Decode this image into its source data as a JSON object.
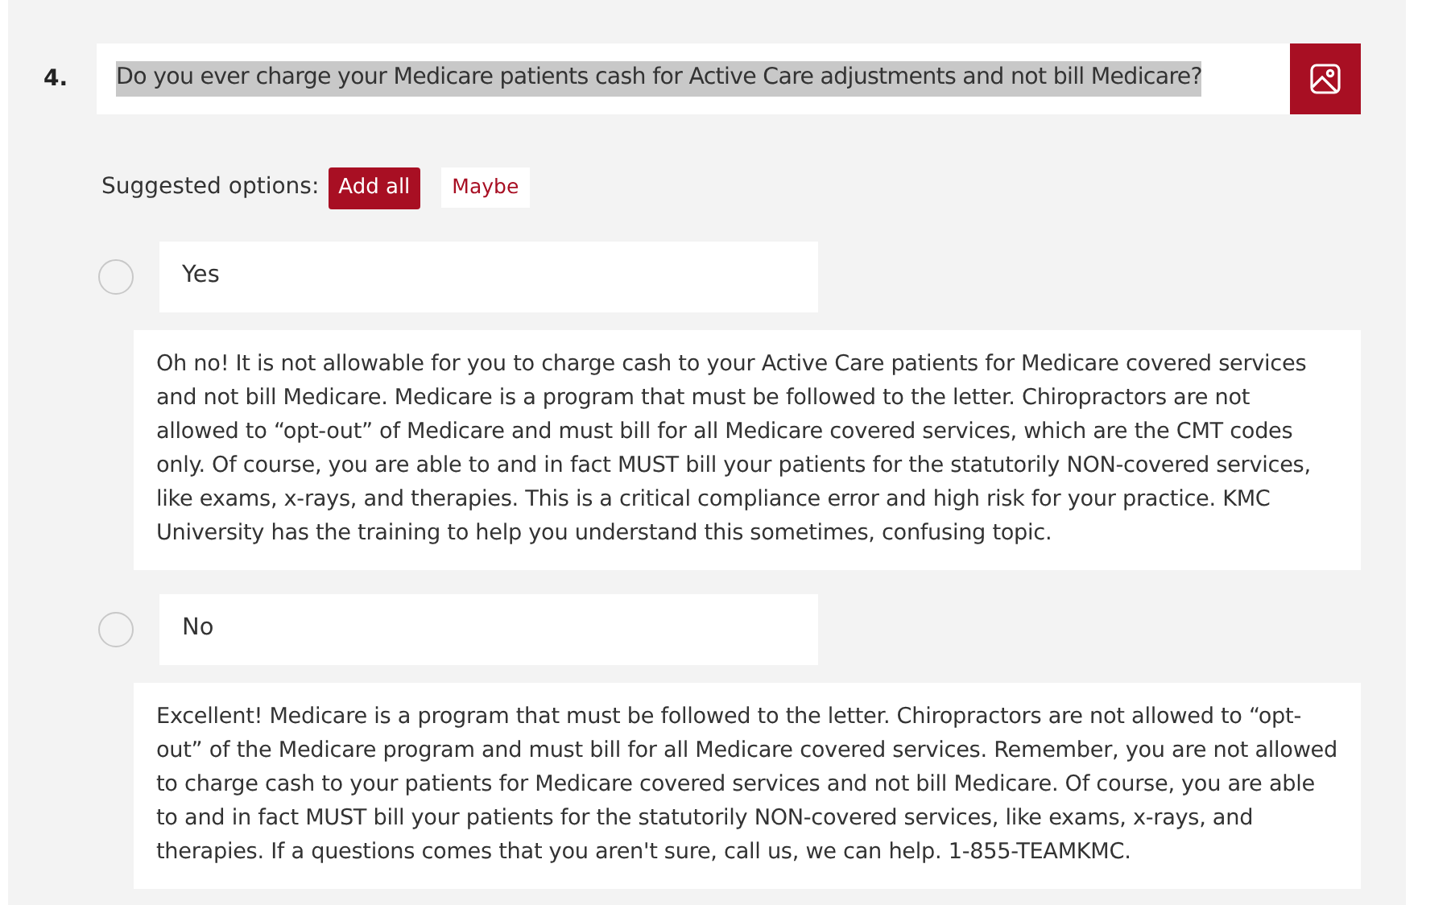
{
  "question": {
    "number": "4.",
    "text": "Do you ever charge your Medicare patients cash for Active Care adjustments and not bill Medicare?"
  },
  "suggested_options": {
    "label": "Suggested options:",
    "buttons": [
      {
        "label": "Add all",
        "kind": "primary"
      },
      {
        "label": "Maybe",
        "kind": "plain"
      }
    ]
  },
  "options": [
    {
      "label": "Yes",
      "selected": false,
      "feedback": "Oh no!  It is not allowable for you to charge cash to your Active Care patients for Medicare covered services and not bill Medicare. Medicare is a program that must be followed to the letter. Chiropractors are not allowed to “opt-out” of Medicare and must bill for all Medicare covered services, which are the CMT codes only.  Of course, you are able to and in fact MUST bill your patients for the statutorily NON-covered services, like exams, x-rays, and therapies. This is a critical compliance error and high risk for your practice. KMC University has the training to help you understand this sometimes, confusing topic."
    },
    {
      "label": "No",
      "selected": false,
      "feedback": "Excellent! Medicare is a program that must be followed to the letter. Chiropractors are not allowed to “opt-out” of the Medicare program and must bill for all Medicare covered services.  Remember, you are not allowed to charge cash to your patients for Medicare covered services and not bill Medicare. Of course, you are able to and in fact MUST bill your patients for the statutorily NON-covered services, like exams, x-rays, and therapies. If a questions comes that you aren't sure, call us, we can help. 1-855-TEAMKMC."
    }
  ]
}
